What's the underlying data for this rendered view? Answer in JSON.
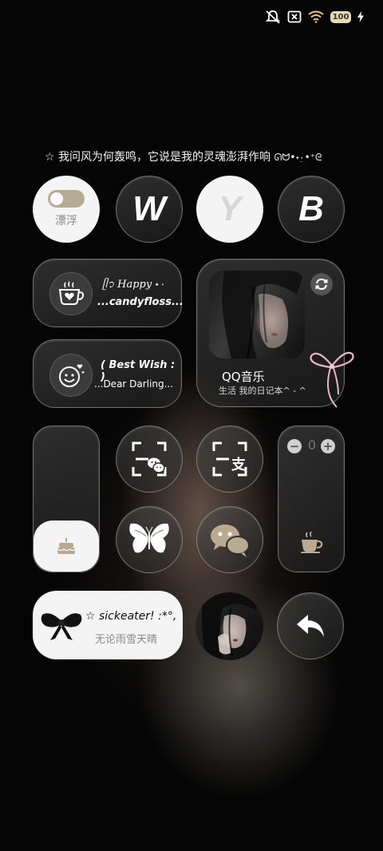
{
  "status_bar": {
    "icons": [
      "mute-icon",
      "no-sim-icon",
      "wifi-icon",
      "battery-icon",
      "charging-icon"
    ],
    "battery_level": "100"
  },
  "quote": {
    "star": "☆",
    "text": "我问风为何轰鸣，它说是我的灵魂澎湃作响",
    "kaomoji": "ᘏᗢ•˖ٜ۰•⁺ᘓ"
  },
  "row1": {
    "toggle_label": "漂浮",
    "toggle_on": false,
    "w": "W",
    "y": "Y",
    "b": "B"
  },
  "card_happy": {
    "line1": "ᥫ᭡ Happy ˖۰",
    "line2": "...candyfloss..."
  },
  "card_wish": {
    "line1": "( Best  Wish : )",
    "line2": "...Dear Darling..."
  },
  "music": {
    "app_name": "QQ音乐",
    "subtitle": "生活 我的日记本^ - ^"
  },
  "stepper": {
    "minus": "−",
    "value": "0",
    "plus": "+"
  },
  "bottom_card": {
    "title": "☆ sickeater! :*°,",
    "subtitle": "无论雨雪天晴"
  },
  "colors": {
    "accent_beige": "#b9aa90",
    "accent_gold": "#c7b48a",
    "ribbon_pink": "#e9b6c6"
  }
}
